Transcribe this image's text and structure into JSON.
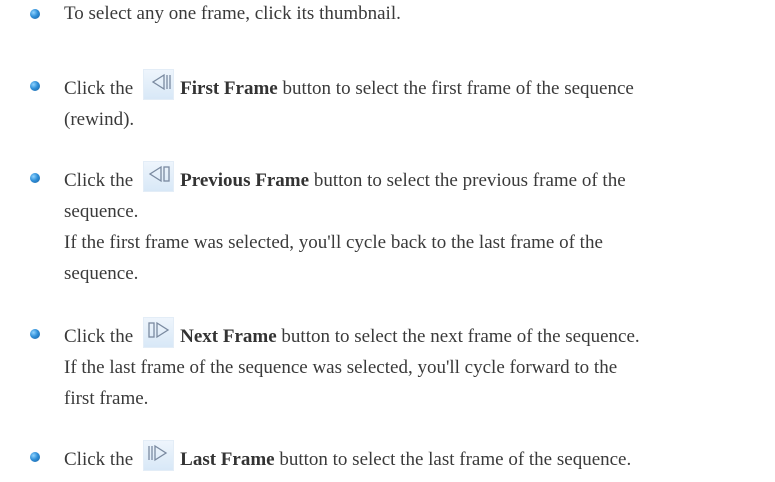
{
  "items": [
    {
      "line1": "To select any one frame, click its thumbnail."
    },
    {
      "prefix": "Click the",
      "button_label": "First Frame",
      "icon": "first-frame-icon",
      "suffix": "button to select the first frame of the sequence",
      "line2": "(rewind)."
    },
    {
      "prefix": "Click the",
      "button_label": "Previous Frame",
      "icon": "previous-frame-icon",
      "suffix": "button to select the previous frame of the",
      "line2": "sequence.",
      "line3": "If the first frame was selected, you'll cycle back to the last frame of the",
      "line4": "sequence."
    },
    {
      "prefix": "Click the",
      "button_label": "Next Frame",
      "icon": "next-frame-icon",
      "suffix": "button to select the next frame of the sequence.",
      "line2": "If the last frame of the sequence was selected, you'll cycle forward to the",
      "line3": "first frame."
    },
    {
      "prefix": "Click the",
      "button_label": "Last Frame",
      "icon": "last-frame-icon",
      "suffix": "button to select the last frame of the sequence."
    }
  ],
  "colors": {
    "text": "#3a3a3a",
    "bullet": "#2f8fd8",
    "button_bg": "#dce9f6",
    "icon_stroke": "#7a8aa0"
  }
}
